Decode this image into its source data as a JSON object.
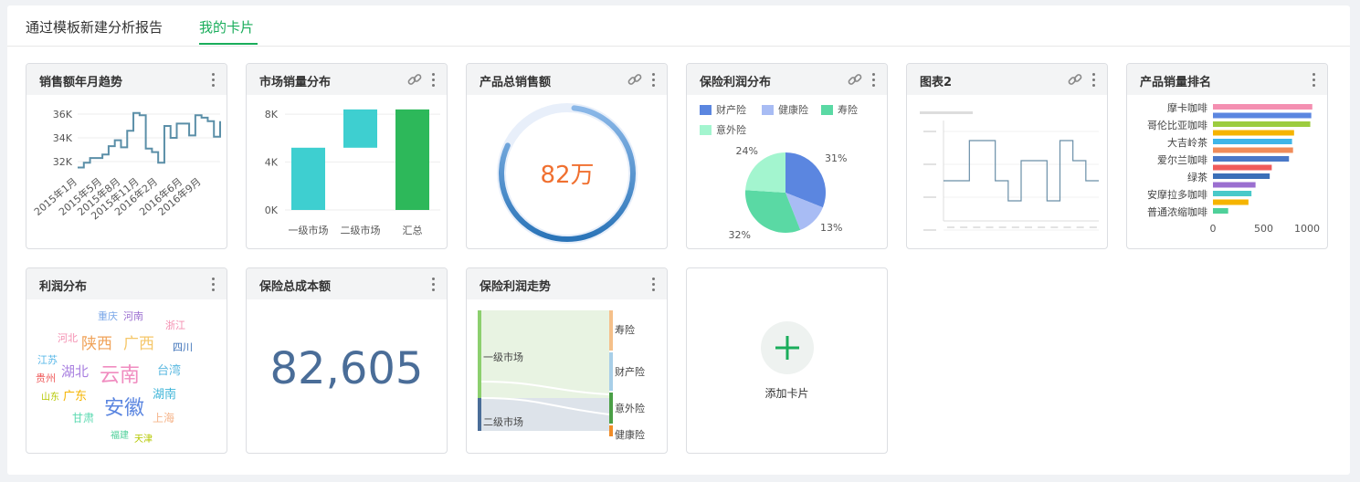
{
  "tabs": [
    {
      "label": "通过模板新建分析报告",
      "active": false
    },
    {
      "label": "我的卡片",
      "active": true
    }
  ],
  "cards": {
    "sales_trend": {
      "title": "销售额年月趋势"
    },
    "market_volume": {
      "title": "市场销量分布"
    },
    "product_total": {
      "title": "产品总销售额",
      "value": "82万",
      "progress": 0.82
    },
    "insurance_profit": {
      "title": "保险利润分布"
    },
    "chart2": {
      "title": "图表2"
    },
    "product_rank": {
      "title": "产品销量排名"
    },
    "profit_dist": {
      "title": "利润分布"
    },
    "insurance_cost": {
      "title": "保险总成本额",
      "value": "82,605"
    },
    "insurance_trend": {
      "title": "保险利润走势"
    },
    "add_card": {
      "label": "添加卡片"
    }
  },
  "chart_data": [
    {
      "type": "line",
      "id": "sales_trend",
      "y_ticks": [
        "32K",
        "34K",
        "36K"
      ],
      "ylim": [
        31000,
        37000
      ],
      "x_ticks": [
        "2015年1月",
        "2015年5月",
        "2015年8月",
        "2015年11月",
        "2016年2月",
        "2016年6月",
        "2016年9月"
      ],
      "x_tick_index": [
        0,
        4,
        7,
        10,
        13,
        17,
        20
      ],
      "values": [
        31500,
        31900,
        32300,
        32300,
        32600,
        33300,
        33800,
        33200,
        34600,
        36100,
        35900,
        33100,
        32800,
        31900,
        35000,
        34000,
        35200,
        35200,
        34200,
        35900,
        35700,
        35400,
        34100,
        35400
      ],
      "color": "#5b8fa8"
    },
    {
      "type": "bar",
      "id": "market_volume",
      "y_ticks": [
        "0K",
        "4K",
        "8K"
      ],
      "ylim": [
        0,
        9000
      ],
      "categories": [
        "一级市场",
        "二级市场",
        "汇总"
      ],
      "bars": [
        {
          "start": 0,
          "end": 5200,
          "color": "#3ecfd0"
        },
        {
          "start": 5200,
          "end": 8400,
          "color": "#3ecfd0"
        },
        {
          "start": 0,
          "end": 8400,
          "color": "#2db85a"
        }
      ]
    },
    {
      "type": "pie",
      "id": "insurance_profit",
      "legend": [
        {
          "name": "财产险",
          "color": "#5b86e0"
        },
        {
          "name": "健康险",
          "color": "#a8bcf4"
        },
        {
          "name": "寿险",
          "color": "#5ad9a4"
        },
        {
          "name": "意外险",
          "color": "#a3f5cf"
        }
      ],
      "slices": [
        {
          "name": "财产险",
          "value": 31,
          "label": "31%",
          "color": "#5b86e0"
        },
        {
          "name": "健康险",
          "value": 13,
          "label": "13%",
          "color": "#a8bcf4"
        },
        {
          "name": "寿险",
          "value": 32,
          "label": "32%",
          "color": "#5ad9a4"
        },
        {
          "name": "意外险",
          "value": 24,
          "label": "24%",
          "color": "#a3f5cf"
        }
      ]
    },
    {
      "type": "line",
      "id": "chart2",
      "values": [
        2,
        2,
        4,
        4,
        2,
        1,
        3,
        3,
        1,
        4,
        3,
        2
      ],
      "ylim": [
        0,
        5
      ],
      "color": "#6a8fa8"
    },
    {
      "type": "bar",
      "id": "product_rank",
      "orientation": "horizontal",
      "x_ticks": [
        "0",
        "500",
        "1000"
      ],
      "xlim": [
        0,
        1000
      ],
      "category_labels": [
        "摩卡咖啡",
        "哥伦比亚咖啡",
        "大吉岭茶",
        "爱尔兰咖啡",
        "绿茶",
        "安摩拉多咖啡",
        "普通浓缩咖啡"
      ],
      "bars": [
        {
          "value": 980,
          "color": "#f48fb1"
        },
        {
          "value": 970,
          "color": "#5b86e0"
        },
        {
          "value": 960,
          "color": "#9ccc3f"
        },
        {
          "value": 800,
          "color": "#f5b400"
        },
        {
          "value": 780,
          "color": "#3fb5e8"
        },
        {
          "value": 790,
          "color": "#f08c5a"
        },
        {
          "value": 750,
          "color": "#4a78c8"
        },
        {
          "value": 580,
          "color": "#ef5b5b"
        },
        {
          "value": 560,
          "color": "#3b70b8"
        },
        {
          "value": 420,
          "color": "#9b6fd0"
        },
        {
          "value": 380,
          "color": "#49c9c9"
        },
        {
          "value": 350,
          "color": "#f5b400"
        },
        {
          "value": 150,
          "color": "#4fd09a"
        }
      ]
    },
    {
      "type": "wordcloud",
      "id": "profit_dist",
      "words": [
        {
          "text": "重庆",
          "color": "#7aa7e8"
        },
        {
          "text": "河南",
          "color": "#9b6fd0"
        },
        {
          "text": "浙江",
          "color": "#f48fb1"
        },
        {
          "text": "河北",
          "color": "#f48fb1"
        },
        {
          "text": "陕西",
          "color": "#f0a35a"
        },
        {
          "text": "广西",
          "color": "#f5c76a"
        },
        {
          "text": "四川",
          "color": "#3b70b8"
        },
        {
          "text": "江苏",
          "color": "#5ab8e8"
        },
        {
          "text": "湖北",
          "color": "#a980e0"
        },
        {
          "text": "云南",
          "color": "#f08cc0"
        },
        {
          "text": "台湾",
          "color": "#5ab8e0"
        },
        {
          "text": "贵州",
          "color": "#ef5b5b"
        },
        {
          "text": "山东",
          "color": "#b5c800"
        },
        {
          "text": "广东",
          "color": "#f5b400"
        },
        {
          "text": "安徽",
          "color": "#5b86e0"
        },
        {
          "text": "湖南",
          "color": "#3fb5d8"
        },
        {
          "text": "甘肃",
          "color": "#5ad9b0"
        },
        {
          "text": "上海",
          "color": "#f5b48a"
        },
        {
          "text": "福建",
          "color": "#4fd09a"
        },
        {
          "text": "天津",
          "color": "#b5c800"
        }
      ]
    },
    {
      "type": "sankey",
      "id": "insurance_trend",
      "sources": [
        {
          "name": "一级市场",
          "color": "#8ccf6e"
        },
        {
          "name": "二级市场",
          "color": "#4a6d98"
        }
      ],
      "targets": [
        {
          "name": "寿险",
          "color": "#f5c08a"
        },
        {
          "name": "财产险",
          "color": "#a8cfe8"
        },
        {
          "name": "意外险",
          "color": "#4a9f46"
        },
        {
          "name": "健康险",
          "color": "#f08c28"
        }
      ]
    }
  ]
}
